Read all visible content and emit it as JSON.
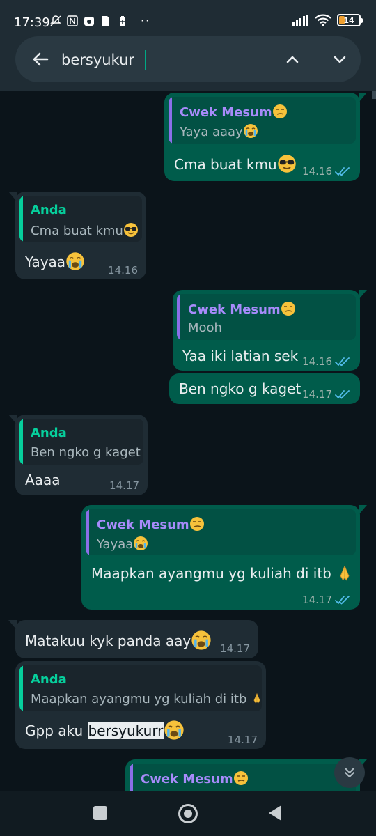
{
  "status": {
    "time": "17:39",
    "battery": "14",
    "dots": "··"
  },
  "search": {
    "query": "bersyukur",
    "icons": {
      "back": "back-arrow-icon",
      "up": "chevron-up-icon",
      "down": "chevron-down-icon"
    }
  },
  "messages": [
    {
      "dir": "out",
      "quote_name": "Cwek Mesum",
      "quote_text": "Yaya aaay",
      "text": "Cma buat kmu",
      "time": "14.16"
    },
    {
      "dir": "in",
      "quote_name": "Anda",
      "quote_text": "Cma buat kmu",
      "text": "Yayaa",
      "time": "14.16"
    },
    {
      "dir": "out",
      "quote_name": "Cwek Mesum",
      "quote_text": "Mooh",
      "text": "Yaa iki latian sek",
      "time": "14.16"
    },
    {
      "dir": "out",
      "text": "Ben ngko g kaget",
      "time": "14.17"
    },
    {
      "dir": "in",
      "quote_name": "Anda",
      "quote_text": "Ben ngko g kaget",
      "text": "Aaaa",
      "time": "14.17"
    },
    {
      "dir": "out",
      "quote_name": "Cwek Mesum",
      "quote_text": "Yayaa",
      "text": "Maapkan ayangmu yg kuliah di itb",
      "time": "14.17"
    },
    {
      "dir": "in",
      "text": "Matakuu kyk panda aay",
      "time": "14.17"
    },
    {
      "dir": "in",
      "quote_name": "Anda",
      "quote_text": "Maapkan ayangmu yg kuliah di itb",
      "text_before": "Gpp aku ",
      "text_highlight": "bersyukurr",
      "time": "14.17"
    },
    {
      "dir": "out",
      "quote_name": "Cwek Mesum"
    }
  ],
  "colors": {
    "outgoing_bubble": "#005c4b",
    "incoming_bubble": "#1f2c34",
    "background": "#0b141a",
    "read_ticks": "#53bdeb",
    "quote_name_purple": "#a78bfa",
    "quote_name_green": "#06cf9c"
  }
}
